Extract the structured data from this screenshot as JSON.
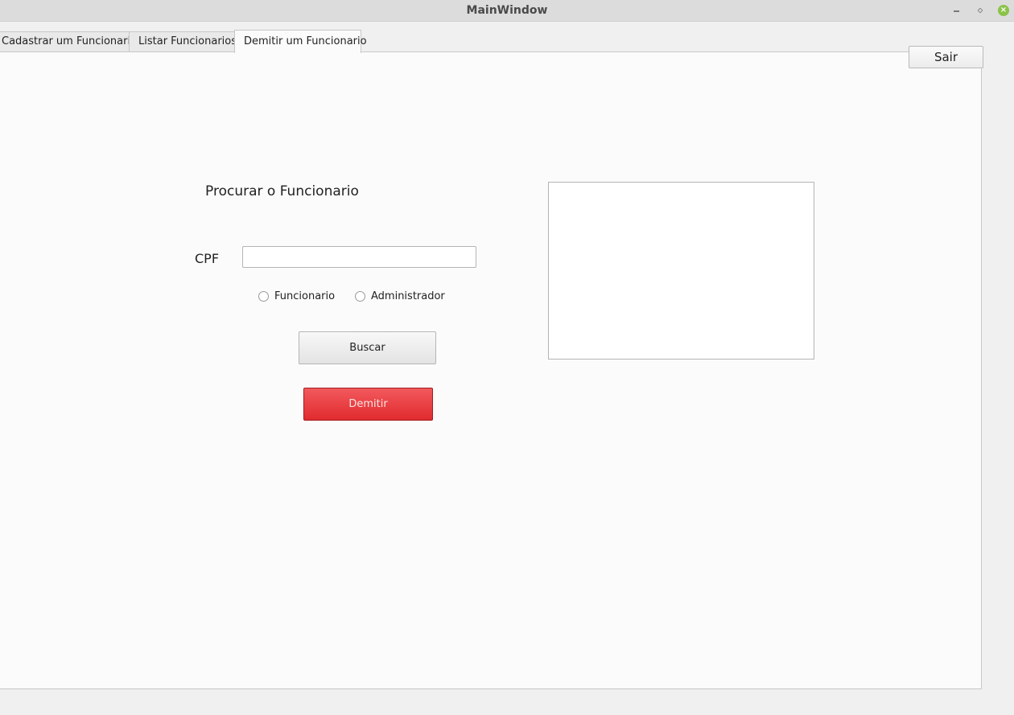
{
  "window": {
    "title": "MainWindow",
    "controls": {
      "minimize_icon": "minimize-icon",
      "maximize_icon": "maximize-icon",
      "close_icon": "close-icon",
      "close_glyph": "×"
    }
  },
  "tabs": [
    {
      "label": "Cadastrar um Funcionario",
      "selected": false
    },
    {
      "label": "Listar Funcionarios",
      "selected": false
    },
    {
      "label": "Demitir um Funcionario",
      "selected": true
    }
  ],
  "toolbar": {
    "exit_label": "Sair"
  },
  "form": {
    "heading": "Procurar o Funcionario",
    "cpf_label": "CPF",
    "cpf_value": "",
    "cpf_placeholder": "",
    "radio_options": [
      {
        "label": "Funcionario",
        "checked": false
      },
      {
        "label": "Administrador",
        "checked": false
      }
    ],
    "search_label": "Buscar",
    "dismiss_label": "Demitir"
  },
  "result_box": {
    "content": ""
  },
  "colors": {
    "dismiss_button": "#e53236",
    "panel_background": "#fbfbfb",
    "titlebar_background": "#dcdcdc",
    "close_button": "#8bc34a"
  }
}
